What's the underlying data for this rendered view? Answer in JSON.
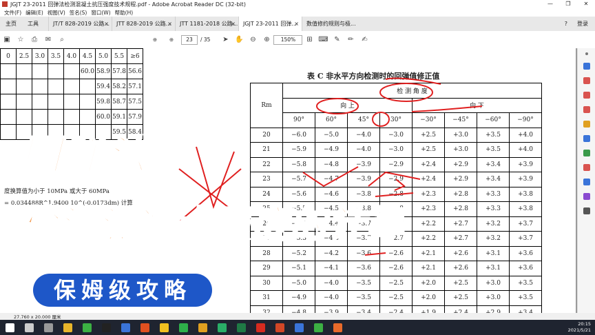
{
  "window": {
    "title": "JGJT 23-2011 回弹法检测混凝土抗压强度技术规程.pdf - Adobe Acrobat Reader DC (32-bit)"
  },
  "menu": [
    "文件(F)",
    "编辑(E)",
    "视图(V)",
    "签名(S)",
    "窗口(W)",
    "帮助(H)"
  ],
  "tabs": {
    "home": "主页",
    "tools": "工具",
    "items": [
      "JT/T 828-2019 公路...",
      "JTT 828-2019 公路...",
      "JTT 1181-2018 公路...",
      "JGJT 23-2011 回弹...",
      "数值修约规则与极..."
    ],
    "help": "?",
    "login": "登录"
  },
  "toolbar": {
    "page_current": "23",
    "page_total": "/ 35",
    "zoom": "150%"
  },
  "left_table": {
    "header": [
      "0",
      "2.5",
      "3.0",
      "3.5",
      "4.0",
      "4.5",
      "5.0",
      "5.5",
      "≥6"
    ],
    "rows": [
      [
        "",
        "",
        "",
        "",
        "",
        "60.0",
        "58.9",
        "57.8",
        "56.6"
      ],
      [
        "",
        "",
        "",
        "",
        "",
        "",
        "59.4",
        "58.2",
        "57.1"
      ],
      [
        "",
        "",
        "",
        "",
        "",
        "",
        "59.8",
        "58.7",
        "57.5"
      ],
      [
        "",
        "",
        "",
        "",
        "",
        "",
        "60.0",
        "59.1",
        "57.9"
      ],
      [
        "",
        "",
        "",
        "",
        "",
        "",
        "",
        "59.5",
        "58.4"
      ]
    ]
  },
  "left_notes": [
    "度换算值为小于 10MPa 或大于 60MPa",
    "= 0.034488R^1.9400 10^(-0.0173dm) 计算"
  ],
  "right_table": {
    "title": "表 C   非水平方向检测时的回弹值修正值",
    "group": "检 测 角 度",
    "up": "向 上",
    "down": "向 下",
    "rm": "Rm",
    "angles": [
      "90°",
      "60°",
      "45°",
      "30°",
      "−30°",
      "−45°",
      "−60°",
      "−90°"
    ],
    "rows": [
      [
        "20",
        "−6.0",
        "−5.0",
        "−4.0",
        "−3.0",
        "+2.5",
        "+3.0",
        "+3.5",
        "+4.0"
      ],
      [
        "21",
        "−5.9",
        "−4.9",
        "−4.0",
        "−3.0",
        "+2.5",
        "+3.0",
        "+3.5",
        "+4.0"
      ],
      [
        "22",
        "−5.8",
        "−4.8",
        "−3.9",
        "−2.9",
        "+2.4",
        "+2.9",
        "+3.4",
        "+3.9"
      ],
      [
        "23",
        "−5.7",
        "−4.7",
        "−3.9",
        "−2.9",
        "+2.4",
        "+2.9",
        "+3.4",
        "+3.9"
      ],
      [
        "24",
        "−5.6",
        "−4.6",
        "−3.8",
        "−2.8",
        "+2.3",
        "+2.8",
        "+3.3",
        "+3.8"
      ],
      [
        "25",
        "−5.5",
        "−4.5",
        "−3.8",
        "−2.8",
        "+2.3",
        "+2.8",
        "+3.3",
        "+3.8"
      ],
      [
        "26",
        "−5.4",
        "−4.4",
        "−3.7",
        "−2.7",
        "+2.2",
        "+2.7",
        "+3.2",
        "+3.7"
      ],
      [
        "27",
        "−5.3",
        "−4.3",
        "−3.7",
        "−2.7",
        "+2.2",
        "+2.7",
        "+3.2",
        "+3.7"
      ],
      [
        "28",
        "−5.2",
        "−4.2",
        "−3.6",
        "−2.6",
        "+2.1",
        "+2.6",
        "+3.1",
        "+3.6"
      ],
      [
        "29",
        "−5.1",
        "−4.1",
        "−3.6",
        "−2.6",
        "+2.1",
        "+2.6",
        "+3.1",
        "+3.6"
      ],
      [
        "30",
        "−5.0",
        "−4.0",
        "−3.5",
        "−2.5",
        "+2.0",
        "+2.5",
        "+3.0",
        "+3.5"
      ],
      [
        "31",
        "−4.9",
        "−4.0",
        "−3.5",
        "−2.5",
        "+2.0",
        "+2.5",
        "+3.0",
        "+3.5"
      ],
      [
        "32",
        "−4.8",
        "−3.9",
        "−3.4",
        "−2.4",
        "+1.9",
        "+2.4",
        "+2.9",
        "+3.4"
      ]
    ]
  },
  "overlay": {
    "line1": "回弹法",
    "line2": "检测混凝土强度的计算",
    "badge": "保姆级攻略"
  },
  "status": {
    "size": "27.760 x 20.000 厘米"
  },
  "taskbar": {
    "time": "20:15",
    "date": "2021/5/21"
  }
}
